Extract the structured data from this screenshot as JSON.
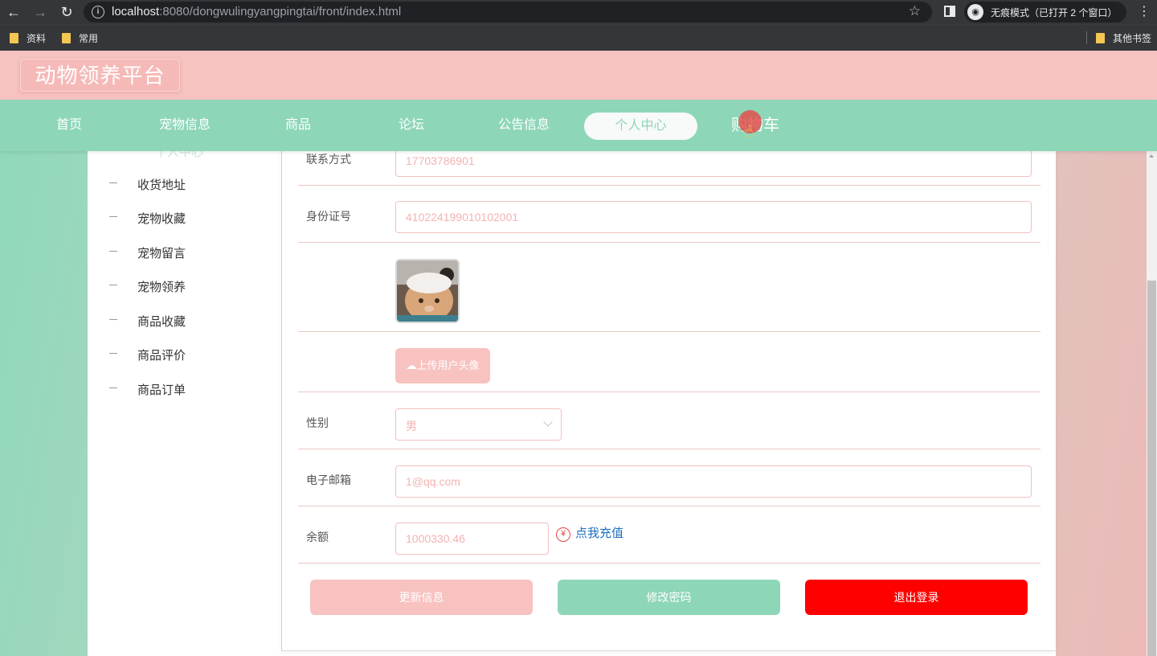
{
  "browser": {
    "url_host": "localhost",
    "url_rest": ":8080/dongwulingyangpingtai/front/index.html",
    "incognito_label": "无痕模式（已打开 2 个窗口）",
    "bookmarks": [
      "资料",
      "常用"
    ],
    "other_bookmarks": "其他书签"
  },
  "header": {
    "logo": "动物领养平台"
  },
  "nav": {
    "items": [
      "首页",
      "宠物信息",
      "商品",
      "论坛",
      "公告信息",
      "个人中心",
      "购物车"
    ],
    "active": "个人中心"
  },
  "sidebar": {
    "title": "个人中心",
    "items": [
      "收货地址",
      "宠物收藏",
      "宠物留言",
      "宠物领养",
      "商品收藏",
      "商品评价",
      "商品订单"
    ]
  },
  "form": {
    "phone_label": "联系方式",
    "phone_value": "17703786901",
    "id_label": "身份证号",
    "id_value": "410224199010102001",
    "upload_label": "上传用户头像",
    "gender_label": "性别",
    "gender_value": "男",
    "email_label": "电子邮箱",
    "email_value": "1@qq.com",
    "balance_label": "余额",
    "balance_value": "1000330.46",
    "recharge_label": "点我充值"
  },
  "buttons": {
    "update": "更新信息",
    "change_password": "修改密码",
    "logout": "退出登录"
  },
  "colors": {
    "header_pink": "#f6c3c1",
    "nav_green": "#8ed6b8",
    "logout_red": "#ff0000"
  }
}
